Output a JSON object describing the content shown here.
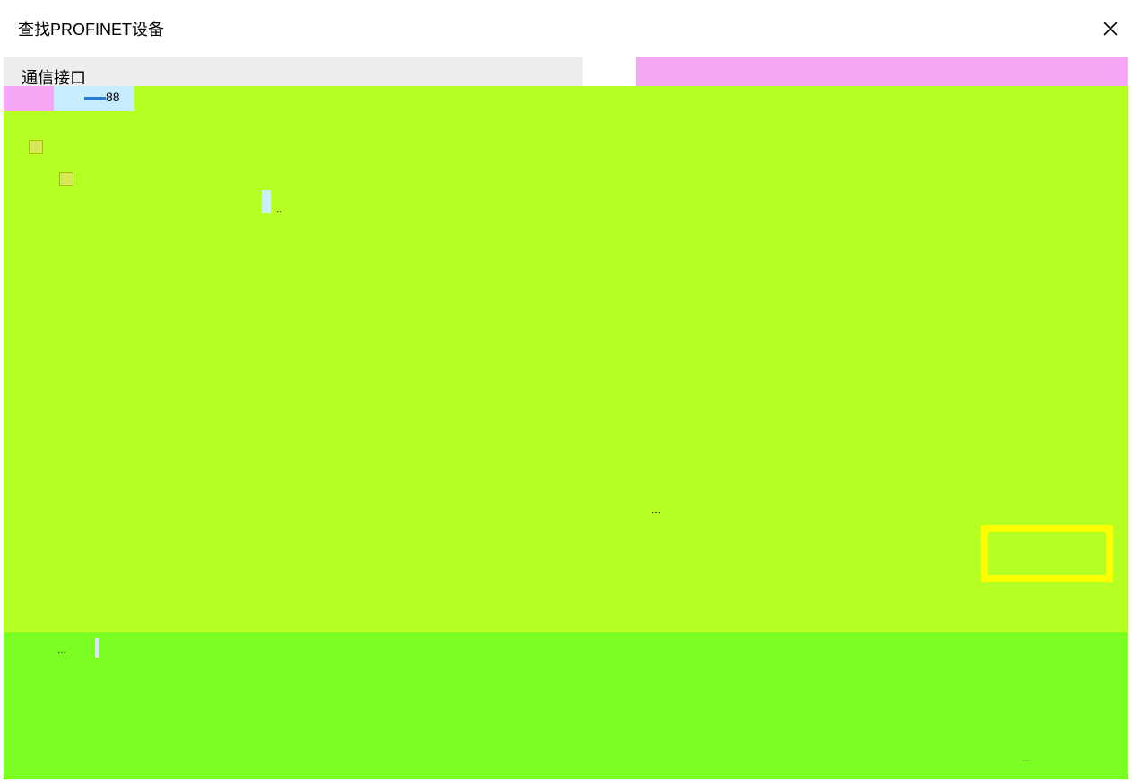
{
  "dialog": {
    "title": "查找PROFINET设备",
    "close_icon": "close-icon"
  },
  "section": {
    "label": "通信接口"
  },
  "tree": {
    "chip_glyph": "88",
    "selected_suffix": "..",
    "center_ellipsis": "..."
  },
  "bottom": {
    "status_glyph": "...",
    "corner_glyph": "..."
  },
  "colors": {
    "main_panel": "#b5ff22",
    "bottom_panel": "#7bff22",
    "highlight_button_border": "#ffff00",
    "header_band": "#f3a6f1"
  }
}
